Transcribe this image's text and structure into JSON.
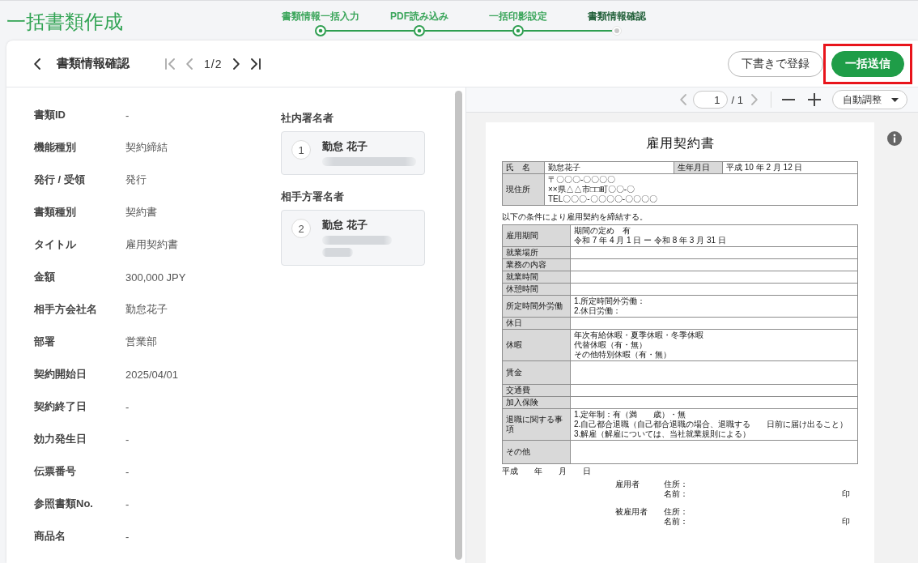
{
  "app_title": "一括書類作成",
  "stepper": [
    {
      "label": "書類情報一括入力",
      "completed": true
    },
    {
      "label": "PDF読み込み",
      "completed": true
    },
    {
      "label": "一括印影設定",
      "completed": true
    },
    {
      "label": "書類情報確認",
      "completed": false
    }
  ],
  "header": {
    "title": "書類情報確認",
    "pager": {
      "first_disabled": true,
      "prev_disabled": true,
      "current": "1/2",
      "next_disabled": false,
      "last_disabled": false
    },
    "buttons": [
      {
        "label": "下書きで登録",
        "kind": "outline",
        "highlighted": false
      },
      {
        "label": "一括送信",
        "kind": "primary",
        "highlighted": true
      }
    ]
  },
  "fields": [
    {
      "label": "書類ID",
      "value": "-"
    },
    {
      "label": "機能種別",
      "value": "契約締結"
    },
    {
      "label": "発行 / 受領",
      "value": "発行"
    },
    {
      "label": "書類種別",
      "value": "契約書"
    },
    {
      "label": "タイトル",
      "value": "雇用契約書"
    },
    {
      "label": "金額",
      "value": "300,000 JPY"
    },
    {
      "label": "相手方会社名",
      "value": "勤怠花子"
    },
    {
      "label": "部署",
      "value": "営業部"
    },
    {
      "label": "契約開始日",
      "value": "2025/04/01"
    },
    {
      "label": "契約終了日",
      "value": "-"
    },
    {
      "label": "効力発生日",
      "value": "-"
    },
    {
      "label": "伝票番号",
      "value": "-"
    },
    {
      "label": "参照書類No.",
      "value": "-"
    },
    {
      "label": "商品名",
      "value": "-"
    }
  ],
  "signers": [
    {
      "heading": "社内署名者",
      "number": "1",
      "name": "勤怠 花子",
      "kind": "single"
    },
    {
      "heading": "相手方署名者",
      "number": "2",
      "name": "勤怠 花子",
      "kind": "wrapped"
    }
  ],
  "viewer": {
    "prev_disabled": true,
    "page": "1",
    "total": "/ 1",
    "next_disabled": true,
    "zoom": "自動調整"
  },
  "document": {
    "title": "雇用契約書",
    "info": {
      "name_label": "氏　名",
      "name": "勤怠花子",
      "birth_label": "生年月日",
      "birth": "平成 10 年 2 月 12 日",
      "address_label": "現住所",
      "address_lines": [
        "〒〇〇〇-〇〇〇〇",
        "××県△△市□□町〇〇-〇",
        "TEL〇〇〇-〇〇〇〇-〇〇〇〇"
      ]
    },
    "intro": "以下の条件により雇用契約を締結する。",
    "terms": [
      {
        "label": "雇用期間",
        "lines": [
          "期間の定め　有",
          "令和 7 年 4 月 1 日 ー 令和 8 年 3 月 31 日"
        ],
        "tall": false
      },
      {
        "label": "就業場所",
        "tall": false
      },
      {
        "label": "業務の内容",
        "tall": false
      },
      {
        "label": "就業時間",
        "tall": false
      },
      {
        "label": "休憩時間",
        "tall": false
      },
      {
        "label": "所定時間外労働",
        "lines": [
          "1.所定時間外労働：",
          "2.休日労働："
        ],
        "tall": false
      },
      {
        "label": "休日",
        "tall": false
      },
      {
        "label": "休暇",
        "lines": [
          "年次有給休暇・夏季休暇・冬季休暇",
          "代替休暇（有・無）",
          "その他特別休暇（有・無）"
        ],
        "tall": false
      },
      {
        "label": "賃金",
        "tall": true
      },
      {
        "label": "交通費",
        "tall": false
      },
      {
        "label": "加入保険",
        "tall": false
      },
      {
        "label": "退職に関する事項",
        "lines": [
          "1.定年制：有（満　　歳）・無",
          "2.自己都合退職（自己都合退職の場合、退職する　　日前に届け出ること）",
          "3.解雇（解雇については、当社就業規則による）"
        ],
        "tall": false
      },
      {
        "label": "その他",
        "tall": true
      }
    ],
    "date_line": "平成　　年　　月　　日",
    "signatures": [
      {
        "role": "雇用者",
        "lines": [
          {
            "label": "住所："
          },
          {
            "label": "名前：",
            "seal": "印"
          }
        ]
      },
      {
        "role": "被雇用者",
        "lines": [
          {
            "label": "住所："
          },
          {
            "label": "名前：",
            "seal": "印"
          }
        ]
      }
    ]
  }
}
